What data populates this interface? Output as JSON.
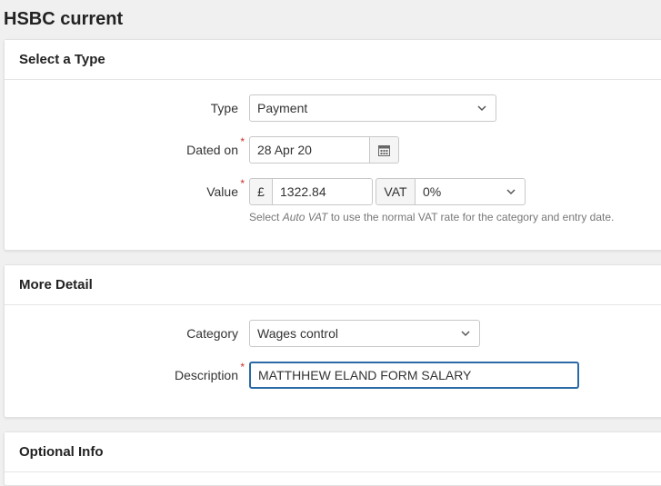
{
  "page": {
    "title": "HSBC current"
  },
  "select_type": {
    "heading": "Select a Type",
    "type": {
      "label": "Type",
      "value": "Payment"
    },
    "dated_on": {
      "label": "Dated on",
      "value": "28 Apr 20"
    },
    "value": {
      "label": "Value",
      "currency": "£",
      "amount": "1322.84",
      "vat_label": "VAT",
      "vat_value": "0%"
    },
    "help": {
      "before": "Select ",
      "em": "Auto VAT",
      "after": " to use the normal VAT rate for the category and entry date."
    }
  },
  "more_detail": {
    "heading": "More Detail",
    "category": {
      "label": "Category",
      "value": "Wages control"
    },
    "description": {
      "label": "Description",
      "value": "MATTHHEW ELAND FORM SALARY"
    }
  },
  "next_panel": {
    "heading": "Optional Info"
  },
  "colors": {
    "required": "#c9302c",
    "focus_border": "#2a6aa6"
  }
}
